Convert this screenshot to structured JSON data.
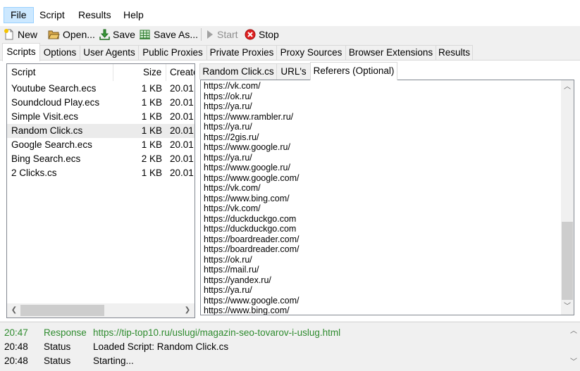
{
  "menu": {
    "file": "File",
    "script": "Script",
    "results": "Results",
    "help": "Help"
  },
  "toolbar": {
    "new": "New",
    "open": "Open...",
    "save": "Save",
    "save_as": "Save As...",
    "start": "Start",
    "stop": "Stop"
  },
  "tabs": {
    "scripts": "Scripts",
    "options": "Options",
    "user_agents": "User Agents",
    "public_proxies": "Public Proxies",
    "private_proxies": "Private Proxies",
    "proxy_sources": "Proxy Sources",
    "browser_extensions": "Browser Extensions",
    "results": "Results"
  },
  "scripts": {
    "columns": {
      "name": "Script",
      "size": "Size",
      "created": "Create"
    },
    "selected_index": 3,
    "rows": [
      {
        "name": "Youtube Search.ecs",
        "size": "1 KB",
        "created": "20.01."
      },
      {
        "name": "Soundcloud Play.ecs",
        "size": "1 KB",
        "created": "20.01."
      },
      {
        "name": "Simple Visit.ecs",
        "size": "1 KB",
        "created": "20.01."
      },
      {
        "name": "Random Click.cs",
        "size": "1 KB",
        "created": "20.01."
      },
      {
        "name": "Google Search.ecs",
        "size": "1 KB",
        "created": "20.01."
      },
      {
        "name": "Bing Search.ecs",
        "size": "2 KB",
        "created": "20.01."
      },
      {
        "name": "2 Clicks.cs",
        "size": "1 KB",
        "created": "20.01."
      }
    ]
  },
  "editor": {
    "tabs": {
      "script": "Random Click.cs",
      "urls": "URL's",
      "referers": "Referers (Optional)"
    },
    "referers": [
      "https://vk.com/",
      "https://ok.ru/",
      "https://ya.ru/",
      "https://www.rambler.ru/",
      "https://ya.ru/",
      "https://2gis.ru/",
      "https://www.google.ru/",
      "https://ya.ru/",
      "https://www.google.ru/",
      "https://www.google.com/",
      "https://vk.com/",
      "https://www.bing.com/",
      "https://vk.com/",
      "https://duckduckgo.com",
      "https://duckduckgo.com",
      "https://boardreader.com/",
      "https://boardreader.com/",
      "https://ok.ru/",
      "https://mail.ru/",
      "https://yandex.ru/",
      "https://ya.ru/",
      "https://www.google.com/",
      "https://www.bing.com/"
    ]
  },
  "log": {
    "rows": [
      {
        "time": "20:47",
        "type": "Response",
        "message": "https://tip-top10.ru/uslugi/magazin-seo-tovarov-i-uslug.html",
        "color": "#2e8b2e"
      },
      {
        "time": "20:48",
        "type": "Status",
        "message": "Loaded Script: Random Click.cs",
        "color": "#000000"
      },
      {
        "time": "20:48",
        "type": "Status",
        "message": "Starting...",
        "color": "#000000"
      }
    ]
  },
  "icons": {
    "new": "new-document-icon",
    "open": "folder-open-icon",
    "save": "save-icon",
    "save_as": "save-as-icon",
    "start": "play-icon",
    "stop": "stop-icon"
  },
  "colors": {
    "menu_selected_bg": "#cce8ff",
    "menu_selected_border": "#99d1ff",
    "row_selected_bg": "#ebebeb",
    "log_response": "#2e8b2e"
  }
}
